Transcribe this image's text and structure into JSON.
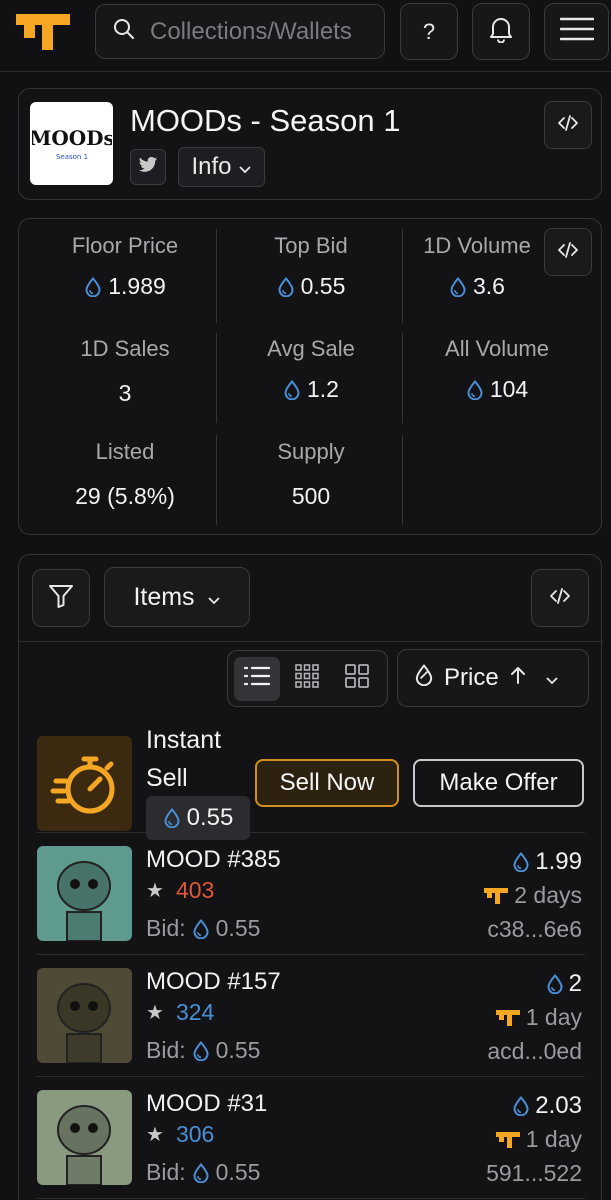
{
  "header": {
    "search_placeholder": "Collections/Wallets",
    "help_label": "?"
  },
  "collection": {
    "title": "MOODs - Season 1",
    "info_label": "Info",
    "logo_text": "MOODs",
    "logo_subtext": "Season 1"
  },
  "stats": {
    "floor_label": "Floor Price",
    "floor_value": "1.989",
    "topbid_label": "Top Bid",
    "topbid_value": "0.55",
    "vol1d_label": "1D Volume",
    "vol1d_value": "3.6",
    "sales1d_label": "1D Sales",
    "sales1d_value": "3",
    "avgsale_label": "Avg Sale",
    "avgsale_value": "1.2",
    "allvol_label": "All Volume",
    "allvol_value": "104",
    "listed_label": "Listed",
    "listed_value": "29 (5.8%)",
    "supply_label": "Supply",
    "supply_value": "500"
  },
  "items_panel": {
    "items_label": "Items",
    "sort_label": "Price",
    "instant_sell_label": "Instant Sell",
    "instant_sell_price": "0.55",
    "sell_now_label": "Sell Now",
    "make_offer_label": "Make Offer"
  },
  "nfts": [
    {
      "name": "MOOD #385",
      "rank": "403",
      "bid_label": "Bid:",
      "bid": "0.55",
      "price": "1.99",
      "time": "2 days",
      "owner": "c38...6e6",
      "rank_color": "#e0573a",
      "bg": "#5f9a8f"
    },
    {
      "name": "MOOD #157",
      "rank": "324",
      "bid_label": "Bid:",
      "bid": "0.55",
      "price": "2",
      "time": "1 day",
      "owner": "acd...0ed",
      "rank_color": "#4a8fd6",
      "bg": "#4f4a35"
    },
    {
      "name": "MOOD #31",
      "rank": "306",
      "bid_label": "Bid:",
      "bid": "0.55",
      "price": "2.03",
      "time": "1 day",
      "owner": "591...522",
      "rank_color": "#4a8fd6",
      "bg": "#8a9a80"
    }
  ],
  "colors": {
    "accent_orange": "#f5a623",
    "drop_blue": "#4a8fd6",
    "background": "#111113"
  }
}
